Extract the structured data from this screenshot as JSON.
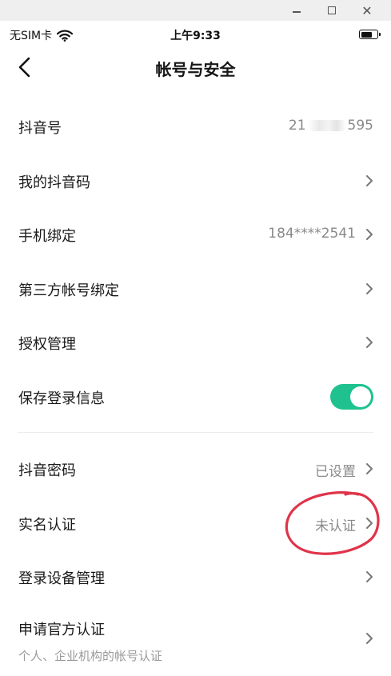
{
  "status_bar": {
    "carrier": "无SIM卡",
    "time": "上午9:33"
  },
  "header": {
    "title": "帐号与安全"
  },
  "rows": {
    "douyin_id": {
      "label": "抖音号",
      "value_prefix": "21",
      "value_suffix": "595"
    },
    "my_qr": {
      "label": "我的抖音码"
    },
    "phone": {
      "label": "手机绑定",
      "value": "184****2541"
    },
    "third_party": {
      "label": "第三方帐号绑定"
    },
    "auth": {
      "label": "授权管理"
    },
    "save_login": {
      "label": "保存登录信息",
      "toggle_on": true
    },
    "password": {
      "label": "抖音密码",
      "value": "已设置"
    },
    "realname": {
      "label": "实名认证",
      "value": "未认证"
    },
    "devices": {
      "label": "登录设备管理"
    },
    "official": {
      "label": "申请官方认证",
      "sublabel": "个人、企业机构的帐号认证"
    }
  },
  "colors": {
    "toggle_on": "#1fc28e",
    "annotation": "#e0344a",
    "secondary_text": "#8a8a8a"
  },
  "icons": {
    "minimize": "minimize-icon",
    "maximize": "maximize-icon",
    "close": "close-icon",
    "wifi": "wifi-icon",
    "battery": "battery-icon",
    "back": "back-arrow-icon",
    "chevron": "chevron-right-icon"
  }
}
